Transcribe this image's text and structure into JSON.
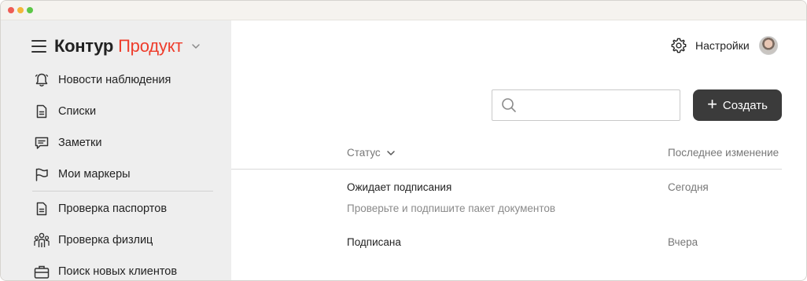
{
  "brand": {
    "name": "Контур",
    "product": "Продукт"
  },
  "nav": {
    "items": [
      {
        "label": "Новости наблюдения",
        "icon": "bell-icon"
      },
      {
        "label": "Списки",
        "icon": "document-icon"
      },
      {
        "label": "Заметки",
        "icon": "chat-note-icon"
      },
      {
        "label": "Мои маркеры",
        "icon": "flag-icon"
      },
      {
        "label": "Проверка паспортов",
        "icon": "document-icon"
      },
      {
        "label": "Проверка физлиц",
        "icon": "people-icon"
      },
      {
        "label": "Поиск новых клиентов",
        "icon": "briefcase-icon"
      }
    ]
  },
  "header": {
    "settings_label": "Настройки"
  },
  "search": {
    "value": "",
    "placeholder": ""
  },
  "create_button": {
    "label": "Создать"
  },
  "table": {
    "columns": {
      "status": "Статус",
      "changed": "Последнее изменение"
    },
    "rows": [
      {
        "status": "Ожидает подписания",
        "hint": "Проверьте и подпишите пакет документов",
        "changed": "Сегодня"
      },
      {
        "status": "Подписана",
        "hint": "",
        "changed": "Вчера"
      }
    ]
  },
  "colors": {
    "brand_red": "#ee3d2c",
    "button_dark": "#3b3b3b",
    "sidebar_bg": "#eeeeee"
  }
}
